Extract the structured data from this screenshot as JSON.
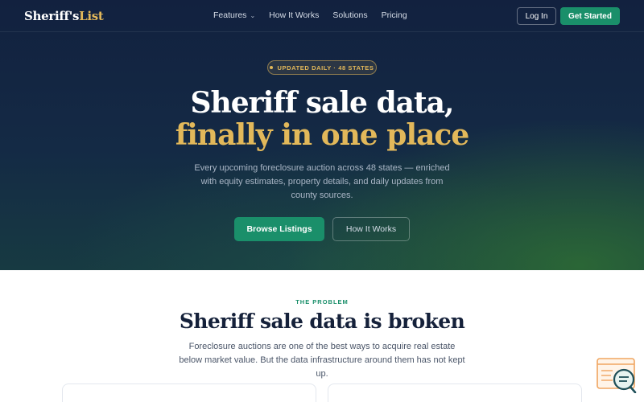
{
  "nav": {
    "logo_part1": "Sheriff's",
    "logo_part2": "List",
    "links": [
      {
        "label": "Features",
        "has_dropdown": true
      },
      {
        "label": "How It Works"
      },
      {
        "label": "Solutions"
      },
      {
        "label": "Pricing"
      }
    ],
    "login_label": "Log In",
    "cta_label": "Get Started"
  },
  "hero": {
    "badge": "UPDATED DAILY · 48 STATES",
    "title_line1": "Sheriff sale data,",
    "title_line2": "finally in one place",
    "subtitle": "Every upcoming foreclosure auction across 48 states — enriched with equity estimates, property details, and daily updates from county sources.",
    "primary_button": "Browse Listings",
    "secondary_button": "How It Works"
  },
  "problem": {
    "eyebrow": "THE PROBLEM",
    "title": "Sheriff sale data is broken",
    "description": "Foreclosure auctions are one of the best ways to acquire real estate below market value. But the data infrastructure around them has not kept up."
  },
  "colors": {
    "accent_green": "#1a8f6a",
    "accent_gold": "#e2b85a",
    "hero_navy": "#12213f",
    "heading_dark": "#15213a"
  },
  "icons": {
    "chat_widget": "chat-support-icon",
    "dropdown": "chevron-down-icon"
  }
}
